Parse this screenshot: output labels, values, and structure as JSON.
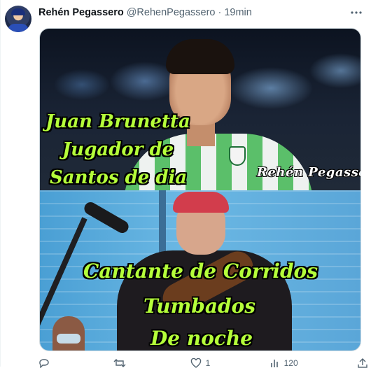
{
  "tweet": {
    "author_name": "Rehén Pegassero",
    "handle": "@RehenPegassero",
    "separator": "·",
    "time": "19min"
  },
  "media": {
    "watermark": "Rehén Pegassero",
    "captions": {
      "line1": "Juan Brunetta",
      "line2": "Jugador de",
      "line3": "Santos de dia",
      "line4": "Cantante de Corridos",
      "line5": "Tumbados",
      "line6": "De noche"
    }
  },
  "actions": {
    "replies": "",
    "retweets": "",
    "likes": "1",
    "views": "120"
  },
  "colors": {
    "caption_green": "#b5ff3a",
    "text_secondary": "#536471"
  },
  "icons": [
    "more-icon",
    "reply-icon",
    "retweet-icon",
    "like-icon",
    "views-icon",
    "share-icon"
  ]
}
